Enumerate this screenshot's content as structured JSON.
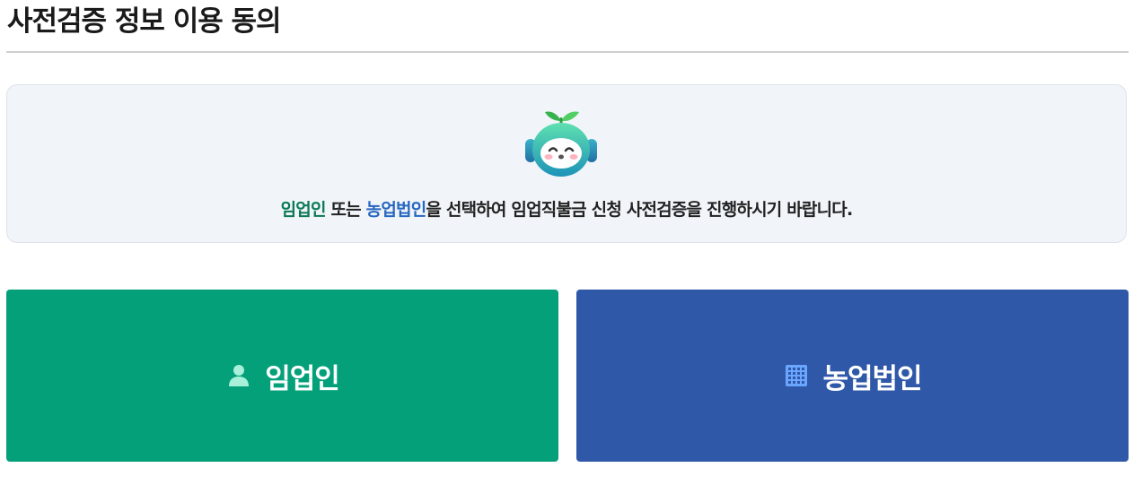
{
  "page": {
    "title": "사전검증 정보 이용 동의"
  },
  "notice": {
    "mascot_icon": "sprout-robot-mascot-icon",
    "text_part1": "임업인",
    "text_part2": " 또는 ",
    "text_part3": "농업법인",
    "text_part4": "을 선택하여 임업직불금 신청 사전검증을 진행하시기 바랍니다.",
    "highlight_color_1": "#0b7a55",
    "highlight_color_2": "#2767c2"
  },
  "choices": [
    {
      "label": "임업인",
      "icon": "person-icon",
      "color": "#03a07a"
    },
    {
      "label": "농업법인",
      "icon": "building-icon",
      "color": "#2f58a8"
    }
  ]
}
